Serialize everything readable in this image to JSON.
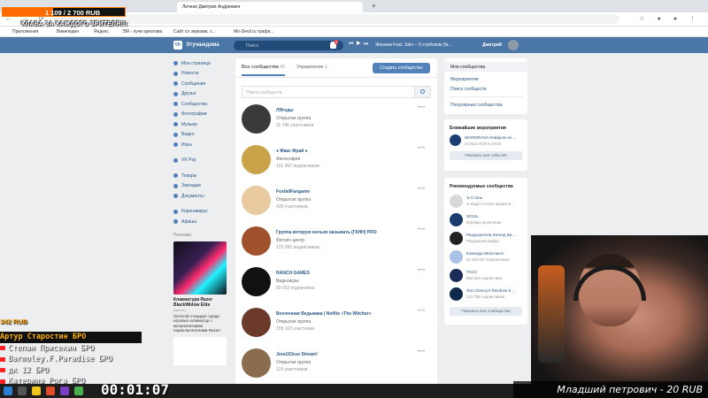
{
  "browser": {
    "tab_title": "Личная Дмитрия Андреевич",
    "bookmarks": [
      "Приложения",
      "Википедия",
      "Яндекс",
      "ЭМ - лучи креатива",
      "Сайт со звуками, т...",
      "Mn-Devil.ru графи..."
    ]
  },
  "header": {
    "brand": "Этучшедома",
    "search_placeholder": "Поиск",
    "notif_count": "5",
    "now_playing": "Жизнем Feat. Jolin – О глубоком (fe...",
    "user_name": "Дмитрий"
  },
  "left_menu": {
    "items": [
      "Моя страница",
      "Новости",
      "Сообщения",
      "Друзья",
      "Сообщества",
      "Фотографии",
      "Музыка",
      "Видео",
      "Игры"
    ],
    "items2": [
      "VK Pay"
    ],
    "items3": [
      "Товары",
      "Закладки",
      "Документы"
    ],
    "items4": [
      "Коронавирус",
      "Афиша"
    ],
    "ad_label": "Реклама",
    "ad_title": "Клавиатура Razer BlackWidow Elite",
    "ad_host": "razer.ru",
    "ad_text": "Золотой стандарт среди игровых клавиатур с механическими переключателями Razer!"
  },
  "main": {
    "tab_all": "Все сообщества",
    "tab_all_count": "41",
    "tab_manage": "Управление",
    "tab_manage_count": "1",
    "create_button": "Создать сообщество",
    "search_placeholder": "Поиск сообществ",
    "groups": [
      {
        "name": "ЛЯгоды",
        "type": "Открытая группа",
        "subs": "11 746 участников"
      },
      {
        "name": "● Макс Фрай ●",
        "type": "Философия",
        "subs": "101 967 подписчиков"
      },
      {
        "name": "FoxfallFangame",
        "type": "Открытая группа",
        "subs": "426 участников"
      },
      {
        "name": "Группа которую нельзя называть (ГКНН) PRO",
        "type": "Фитнес-центр",
        "subs": "122 095 подписчиков"
      },
      {
        "name": "RANCH GAMES",
        "type": "Видеоигры",
        "subs": "50 002 подписчика"
      },
      {
        "name": "Вселенная Ведьмака | Netflix «The Witcher»",
        "type": "Открытая группа",
        "subs": "159 103 участника"
      },
      {
        "name": "Jora163ruo Stream!",
        "type": "Открытая группа",
        "subs": "118 участников"
      }
    ],
    "avatar_colors": [
      "#3a3a3a",
      "#c9a24a",
      "#e8c9a0",
      "#a0522d",
      "#111111",
      "#6b3a2a",
      "#8a6d4e"
    ]
  },
  "right": {
    "nav": {
      "my_groups": "Мои сообщества",
      "events": "Мероприятия",
      "search": "Поиск сообществ",
      "popular": "Популярные сообщества"
    },
    "events_title": "Ближайшие мероприятия",
    "event": {
      "name": "WARDRUNA Нейфолк из ...",
      "date": "24 июн 2020 в 19:00"
    },
    "events_button": "Показать все события",
    "rec_title": "Рекомендуемые сообщества",
    "rec": [
      {
        "name": "Ъ-Стиль",
        "sub": "О моде и стиле вашей ж..."
      },
      {
        "name": "SIGUL",
        "sub": "Игровая вселенная"
      },
      {
        "name": "Разрушители Легенд Ви...",
        "sub": "Разрушаем мифы"
      },
      {
        "name": "Команда ВКонтакте",
        "sub": "11 093 027 подписчиков"
      },
      {
        "name": "ТАСС",
        "sub": "864 554 подписчика"
      },
      {
        "name": "Tom Clancy's Rainbow 6 ...",
        "sub": "121 788 подписчиков"
      }
    ],
    "rec_colors": [
      "#d9d9d9",
      "#1d3c6e",
      "#222222",
      "#a8c3e6",
      "#1c2c58",
      "#0d2a4a"
    ],
    "rec_button": "Показать все сообщества"
  },
  "overlay": {
    "donation_goal": "1 109 / 2 700 RUB",
    "donation_progress": 0.41,
    "ticker": "КЛАВА ЗА КАЖДОГО ЗРИТЕЛЯ!!!",
    "side_total": "342 RUB",
    "donors": [
      "Артур Старостин БРО",
      "Степан Присекин БРО",
      "Barmoley.F.Paradise БРО",
      "дк 12 БРО",
      "Катерина Рога БРО"
    ],
    "timer": "00:01:07",
    "last_donor": "Младший петрович - 20 RUB"
  }
}
